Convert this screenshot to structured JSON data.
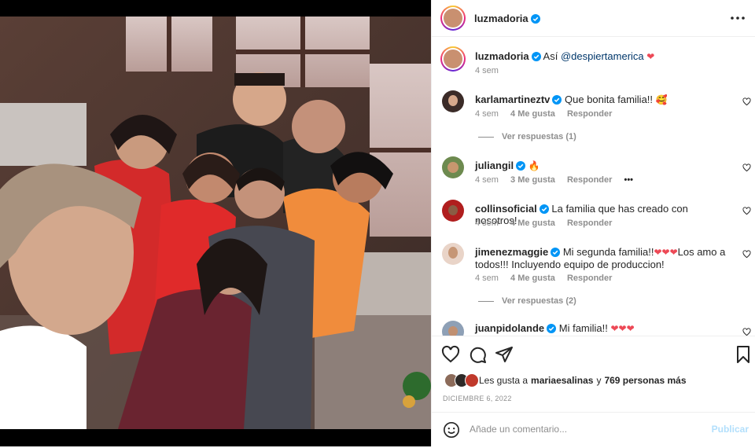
{
  "post": {
    "author": "luzmadoria",
    "photo_alt": "",
    "caption_prefix": "Así",
    "caption_mention": "@despiertamerica",
    "caption_emoji": "❤",
    "caption_time": "4 sem"
  },
  "comments": [
    {
      "user": "karlamartineztv",
      "text": "Que bonita familia!!",
      "emoji": "🥰",
      "time": "4 sem",
      "likes": "4 Me gusta",
      "reply": "Responder",
      "view_replies": "Ver respuestas (1)"
    },
    {
      "user": "juliangil",
      "text": "",
      "emoji": "🔥",
      "time": "4 sem",
      "likes": "3 Me gusta",
      "reply": "Responder",
      "more": "•••"
    },
    {
      "user": "collinsoficial",
      "text": "La familia que has creado con nosotros!",
      "emoji": "",
      "time": "4 sem",
      "likes": "4 Me gusta",
      "reply": "Responder"
    },
    {
      "user": "jimenezmaggie",
      "text_a": "Mi segunda familia!!",
      "text_b": "Los amo a todos!!! Incluyendo equipo de produccion!",
      "emoji": "❤❤❤",
      "time": "4 sem",
      "likes": "4 Me gusta",
      "reply": "Responder",
      "view_replies": "Ver respuestas (2)"
    },
    {
      "user": "juanpidolande",
      "text": "Mi familia!!",
      "emoji": "❤❤❤"
    }
  ],
  "likes": {
    "prefix": "Les gusta a",
    "user": "mariaesalinas",
    "connector": "y",
    "others": "769 personas más"
  },
  "date": "DICIEMBRE 6, 2022",
  "add_comment": {
    "placeholder": "Añade un comentario...",
    "publish": "Publicar"
  },
  "colors": {
    "verified": "#0095f6",
    "heart": "#ed4956",
    "publish_disabled": "#b2dffc",
    "muted": "#8e8e8e"
  }
}
